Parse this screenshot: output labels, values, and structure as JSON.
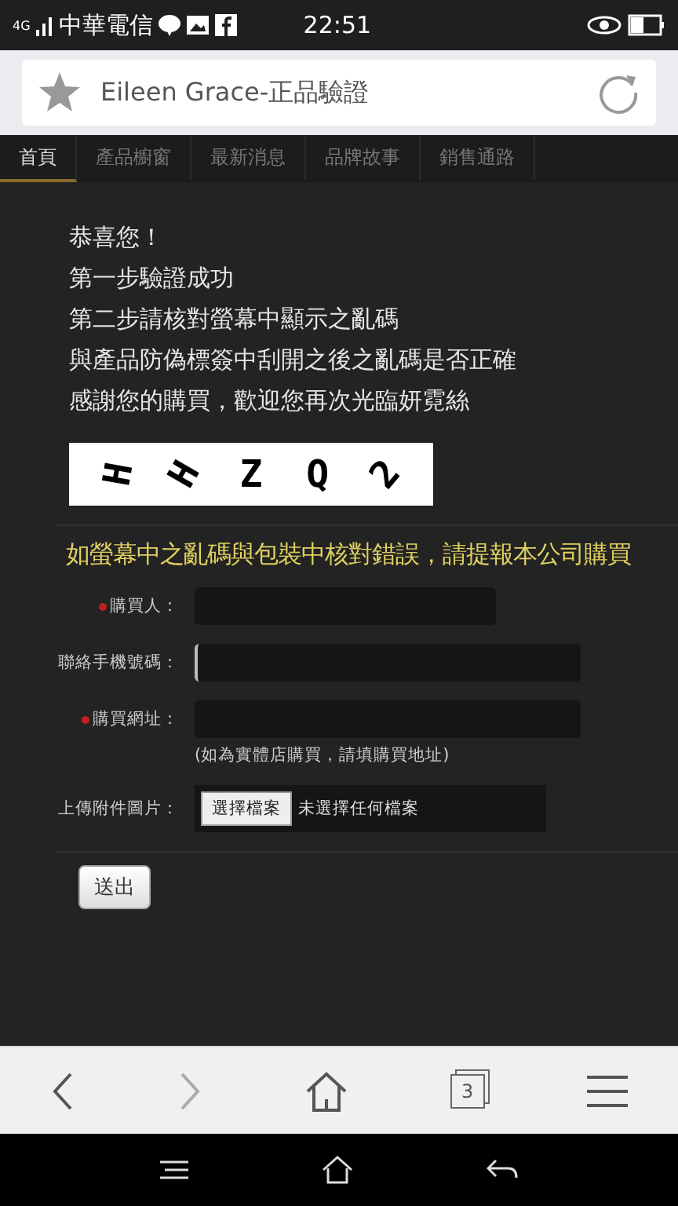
{
  "status_bar": {
    "network": "4G",
    "carrier": "中華電信",
    "time": "22:51"
  },
  "address_bar": {
    "title": "Eileen Grace-正品驗證"
  },
  "nav_tabs": [
    {
      "label": "首頁",
      "selected": true
    },
    {
      "label": "產品櫥窗",
      "selected": false
    },
    {
      "label": "最新消息",
      "selected": false
    },
    {
      "label": "品牌故事",
      "selected": false
    },
    {
      "label": "銷售通路",
      "selected": false
    }
  ],
  "messages": [
    "恭喜您！",
    "第一步驗證成功",
    "第二步請核對螢幕中顯示之亂碼",
    "與產品防偽標簽中刮開之後之亂碼是否正確",
    "感謝您的購買，歡迎您再次光臨妍霓絲"
  ],
  "captcha": [
    "H",
    "H",
    "Z",
    "Q",
    "2"
  ],
  "notice": "如螢幕中之亂碼與包裝中核對錯誤，請提報本公司購買",
  "form": [
    {
      "kind": "short_text",
      "label": "購買人：",
      "required": true,
      "focused": false
    },
    {
      "kind": "text",
      "label": "聯絡手機號碼：",
      "required": false,
      "focused": true
    },
    {
      "kind": "text",
      "label": "購買網址：",
      "required": true,
      "focused": false,
      "hint": "(如為實體店購買，請填購買地址)"
    },
    {
      "kind": "file",
      "label": "上傳附件圖片：",
      "required": false,
      "button": "選擇檔案",
      "value": "未選擇任何檔案"
    }
  ],
  "submit": "送出",
  "browser_toolbar": {
    "tab_count": "3"
  }
}
